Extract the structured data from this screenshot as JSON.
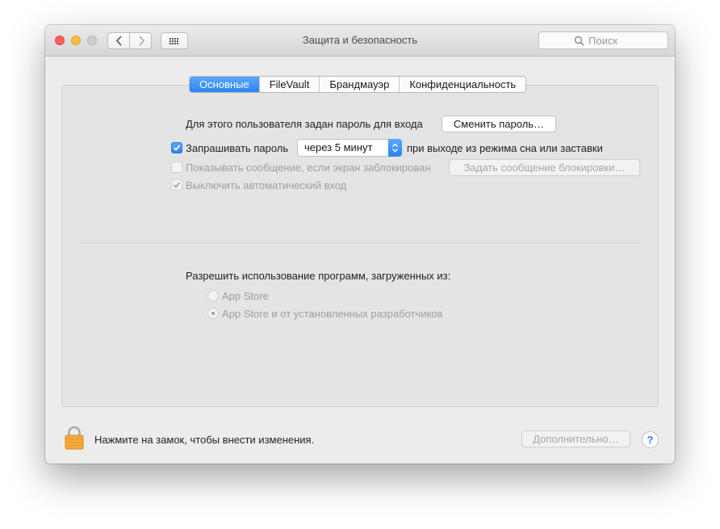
{
  "window": {
    "title": "Защита и безопасность",
    "search_placeholder": "Поиск"
  },
  "tabs": [
    {
      "label": "Основные",
      "active": true
    },
    {
      "label": "FileVault",
      "active": false
    },
    {
      "label": "Брандмауэр",
      "active": false
    },
    {
      "label": "Конфиденциальность",
      "active": false
    }
  ],
  "general": {
    "password_text": "Для этого пользователя задан пароль для входа",
    "change_password_button": "Сменить пароль…",
    "require_password": {
      "label": "Запрашивать пароль",
      "checked": true
    },
    "delay_select": "через 5 минут",
    "after_text": "при выходе из режима сна или заставки",
    "show_message": {
      "label": "Показывать сообщение, если экран заблокирован",
      "checked": false,
      "enabled": false
    },
    "set_lock_message_button": "Задать сообщение блокировки…",
    "disable_autologin": {
      "label": "Выключить автоматический вход",
      "checked": true,
      "enabled": false
    }
  },
  "allow_apps": {
    "label": "Разрешить использование программ, загруженных из:",
    "options": [
      {
        "label": "App Store",
        "selected": false
      },
      {
        "label": "App Store и от установленных разработчиков",
        "selected": true
      }
    ]
  },
  "footer": {
    "lock_text": "Нажмите на замок, чтобы внести изменения.",
    "advanced_button": "Дополнительно…",
    "help_label": "?"
  },
  "colors": {
    "accent": "#2a83f4",
    "lock": "#f4a93a"
  },
  "icons": [
    "back-icon",
    "forward-icon",
    "grid-icon",
    "search-icon",
    "chevron-updown-icon",
    "checkmark-icon",
    "lock-icon",
    "help-icon"
  ]
}
